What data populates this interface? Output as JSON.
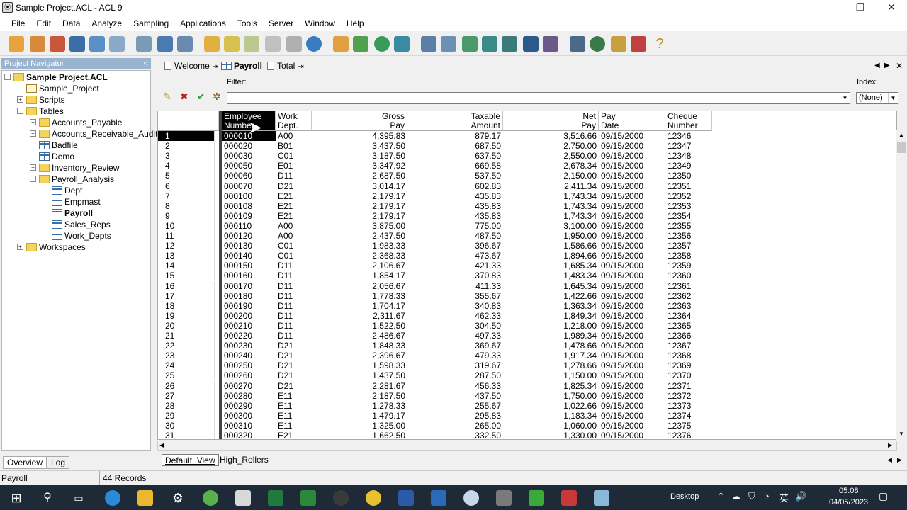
{
  "window": {
    "title": "Sample Project.ACL - ACL 9",
    "min": "—",
    "max": "❐",
    "close": "✕"
  },
  "menu": [
    "File",
    "Edit",
    "Data",
    "Analyze",
    "Sampling",
    "Applications",
    "Tools",
    "Server",
    "Window",
    "Help"
  ],
  "navigator": {
    "header": "Project Navigator",
    "collapse": "<",
    "items": [
      {
        "label": "Sample Project.ACL",
        "icon": "folder-icon",
        "bold": true
      },
      {
        "label": "Sample_Project",
        "icon": "script-icon"
      },
      {
        "label": "Scripts",
        "icon": "folder-icon"
      },
      {
        "label": "Tables",
        "icon": "folder-icon"
      },
      {
        "label": "Accounts_Payable",
        "icon": "folder-icon"
      },
      {
        "label": "Accounts_Receivable_Audit",
        "icon": "folder-icon"
      },
      {
        "label": "Badfile",
        "icon": "table-icon"
      },
      {
        "label": "Demo",
        "icon": "table-icon"
      },
      {
        "label": "Inventory_Review",
        "icon": "folder-icon"
      },
      {
        "label": "Payroll_Analysis",
        "icon": "folder-icon"
      },
      {
        "label": "Dept",
        "icon": "table-icon"
      },
      {
        "label": "Empmast",
        "icon": "table-icon"
      },
      {
        "label": "Payroll",
        "icon": "table-icon",
        "bold": true
      },
      {
        "label": "Sales_Reps",
        "icon": "table-icon"
      },
      {
        "label": "Work_Depts",
        "icon": "table-icon"
      },
      {
        "label": "Workspaces",
        "icon": "folder-icon"
      }
    ],
    "tabs": [
      "Overview",
      "Log"
    ]
  },
  "doc_tabs": [
    "Welcome",
    "Payroll",
    "Total"
  ],
  "filter": {
    "label": "Filter:",
    "value": ""
  },
  "index": {
    "label": "Index:",
    "value": "(None)"
  },
  "columns": [
    "Employee\nNumber",
    "Work\nDept.",
    "Gross\nPay",
    "Taxable\nAmount",
    "Net\nPay",
    "Pay\nDate",
    "Cheque\nNumber"
  ],
  "rows": [
    [
      "1",
      "000010",
      "A00",
      "4,395.83",
      "879.17",
      "3,516.66",
      "09/15/2000",
      "12346"
    ],
    [
      "2",
      "000020",
      "B01",
      "3,437.50",
      "687.50",
      "2,750.00",
      "09/15/2000",
      "12347"
    ],
    [
      "3",
      "000030",
      "C01",
      "3,187.50",
      "637.50",
      "2,550.00",
      "09/15/2000",
      "12348"
    ],
    [
      "4",
      "000050",
      "E01",
      "3,347.92",
      "669.58",
      "2,678.34",
      "09/15/2000",
      "12349"
    ],
    [
      "5",
      "000060",
      "D11",
      "2,687.50",
      "537.50",
      "2,150.00",
      "09/15/2000",
      "12350"
    ],
    [
      "6",
      "000070",
      "D21",
      "3,014.17",
      "602.83",
      "2,411.34",
      "09/15/2000",
      "12351"
    ],
    [
      "7",
      "000100",
      "E21",
      "2,179.17",
      "435.83",
      "1,743.34",
      "09/15/2000",
      "12352"
    ],
    [
      "8",
      "000108",
      "E21",
      "2,179.17",
      "435.83",
      "1,743.34",
      "09/15/2000",
      "12353"
    ],
    [
      "9",
      "000109",
      "E21",
      "2,179.17",
      "435.83",
      "1,743.34",
      "09/15/2000",
      "12354"
    ],
    [
      "10",
      "000110",
      "A00",
      "3,875.00",
      "775.00",
      "3,100.00",
      "09/15/2000",
      "12355"
    ],
    [
      "11",
      "000120",
      "A00",
      "2,437.50",
      "487.50",
      "1,950.00",
      "09/15/2000",
      "12356"
    ],
    [
      "12",
      "000130",
      "C01",
      "1,983.33",
      "396.67",
      "1,586.66",
      "09/15/2000",
      "12357"
    ],
    [
      "13",
      "000140",
      "C01",
      "2,368.33",
      "473.67",
      "1,894.66",
      "09/15/2000",
      "12358"
    ],
    [
      "14",
      "000150",
      "D11",
      "2,106.67",
      "421.33",
      "1,685.34",
      "09/15/2000",
      "12359"
    ],
    [
      "15",
      "000160",
      "D11",
      "1,854.17",
      "370.83",
      "1,483.34",
      "09/15/2000",
      "12360"
    ],
    [
      "16",
      "000170",
      "D11",
      "2,056.67",
      "411.33",
      "1,645.34",
      "09/15/2000",
      "12361"
    ],
    [
      "17",
      "000180",
      "D11",
      "1,778.33",
      "355.67",
      "1,422.66",
      "09/15/2000",
      "12362"
    ],
    [
      "18",
      "000190",
      "D11",
      "1,704.17",
      "340.83",
      "1,363.34",
      "09/15/2000",
      "12363"
    ],
    [
      "19",
      "000200",
      "D11",
      "2,311.67",
      "462.33",
      "1,849.34",
      "09/15/2000",
      "12364"
    ],
    [
      "20",
      "000210",
      "D11",
      "1,522.50",
      "304.50",
      "1,218.00",
      "09/15/2000",
      "12365"
    ],
    [
      "21",
      "000220",
      "D11",
      "2,486.67",
      "497.33",
      "1,989.34",
      "09/15/2000",
      "12366"
    ],
    [
      "22",
      "000230",
      "D21",
      "1,848.33",
      "369.67",
      "1,478.66",
      "09/15/2000",
      "12367"
    ],
    [
      "23",
      "000240",
      "D21",
      "2,396.67",
      "479.33",
      "1,917.34",
      "09/15/2000",
      "12368"
    ],
    [
      "24",
      "000250",
      "D21",
      "1,598.33",
      "319.67",
      "1,278.66",
      "09/15/2000",
      "12369"
    ],
    [
      "25",
      "000260",
      "D21",
      "1,437.50",
      "287.50",
      "1,150.00",
      "09/15/2000",
      "12370"
    ],
    [
      "26",
      "000270",
      "D21",
      "2,281.67",
      "456.33",
      "1,825.34",
      "09/15/2000",
      "12371"
    ],
    [
      "27",
      "000280",
      "E11",
      "2,187.50",
      "437.50",
      "1,750.00",
      "09/15/2000",
      "12372"
    ],
    [
      "28",
      "000290",
      "E11",
      "1,278.33",
      "255.67",
      "1,022.66",
      "09/15/2000",
      "12373"
    ],
    [
      "29",
      "000300",
      "E11",
      "1,479.17",
      "295.83",
      "1,183.34",
      "09/15/2000",
      "12374"
    ],
    [
      "30",
      "000310",
      "E11",
      "1,325.00",
      "265.00",
      "1,060.00",
      "09/15/2000",
      "12375"
    ],
    [
      "31",
      "000320",
      "E21",
      "1,662.50",
      "332.50",
      "1,330.00",
      "09/15/2000",
      "12376"
    ]
  ],
  "view_tabs": [
    "Default_View",
    "High_Rollers"
  ],
  "status": {
    "table": "Payroll",
    "records": "44 Records"
  },
  "taskbar": {
    "desktop": "Desktop",
    "time": "05:08",
    "date": "04/05/2023"
  },
  "colors": {
    "accent": "#99b4d1",
    "selected_row": "#000000",
    "taskbar": "#1f2a38"
  }
}
